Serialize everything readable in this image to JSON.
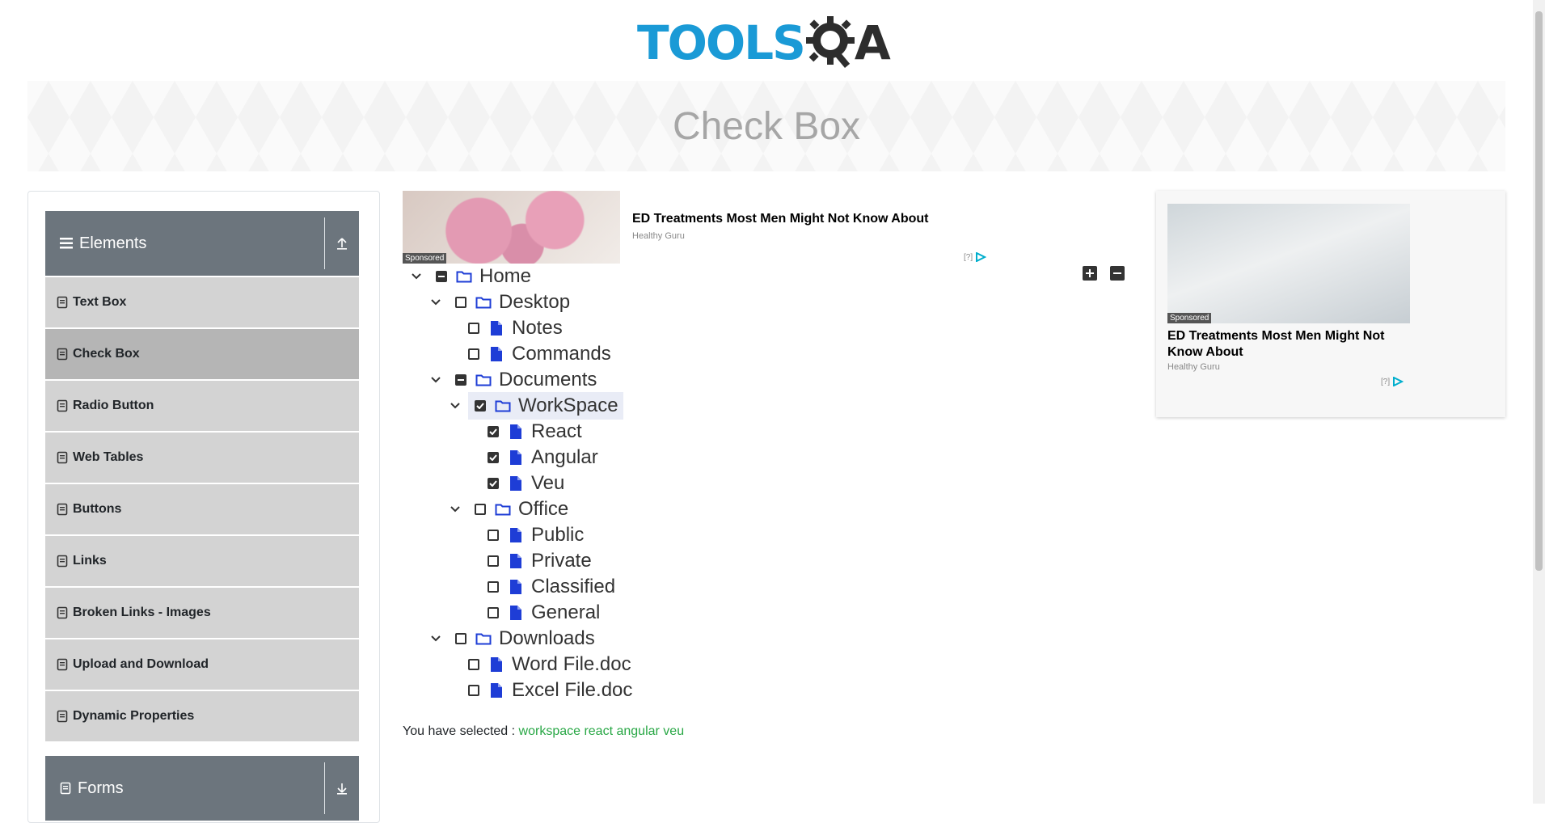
{
  "logo": {
    "text_left": "TOOLS",
    "text_right": "QA"
  },
  "banner": {
    "title": "Check Box"
  },
  "sidebar": {
    "groups": [
      {
        "title": "Elements",
        "expanded": true,
        "items": [
          {
            "label": "Text Box"
          },
          {
            "label": "Check Box",
            "active": true
          },
          {
            "label": "Radio Button"
          },
          {
            "label": "Web Tables"
          },
          {
            "label": "Buttons"
          },
          {
            "label": "Links"
          },
          {
            "label": "Broken Links - Images"
          },
          {
            "label": "Upload and Download"
          },
          {
            "label": "Dynamic Properties"
          }
        ]
      },
      {
        "title": "Forms",
        "expanded": false
      }
    ]
  },
  "ads": {
    "top": {
      "sponsored": "Sponsored",
      "title": "ED Treatments Most Men Might Not Know About",
      "source": "Healthy Guru",
      "mark": "[?]"
    },
    "side": {
      "sponsored": "Sponsored",
      "title": "ED Treatments Most Men Might Not Know About",
      "source": "Healthy Guru",
      "mark": "[?]"
    }
  },
  "tree": [
    {
      "label": "Home",
      "type": "folder",
      "state": "half"
    },
    {
      "label": "Desktop",
      "type": "folder",
      "state": "unchecked"
    },
    {
      "label": "Notes",
      "type": "file",
      "state": "unchecked"
    },
    {
      "label": "Commands",
      "type": "file",
      "state": "unchecked"
    },
    {
      "label": "Documents",
      "type": "folder",
      "state": "half"
    },
    {
      "label": "WorkSpace",
      "type": "folder",
      "state": "checked"
    },
    {
      "label": "React",
      "type": "file",
      "state": "checked"
    },
    {
      "label": "Angular",
      "type": "file",
      "state": "checked"
    },
    {
      "label": "Veu",
      "type": "file",
      "state": "checked"
    },
    {
      "label": "Office",
      "type": "folder",
      "state": "unchecked"
    },
    {
      "label": "Public",
      "type": "file",
      "state": "unchecked"
    },
    {
      "label": "Private",
      "type": "file",
      "state": "unchecked"
    },
    {
      "label": "Classified",
      "type": "file",
      "state": "unchecked"
    },
    {
      "label": "General",
      "type": "file",
      "state": "unchecked"
    },
    {
      "label": "Downloads",
      "type": "folder",
      "state": "unchecked"
    },
    {
      "label": "Word File.doc",
      "type": "file",
      "state": "unchecked"
    },
    {
      "label": "Excel File.doc",
      "type": "file",
      "state": "unchecked"
    }
  ],
  "result": {
    "prefix": "You have selected :",
    "selected": "workspace react angular veu"
  },
  "colors": {
    "accent_folder": "#1e3dd6",
    "selected_text": "#28a745",
    "header_bg": "#6c757d"
  }
}
